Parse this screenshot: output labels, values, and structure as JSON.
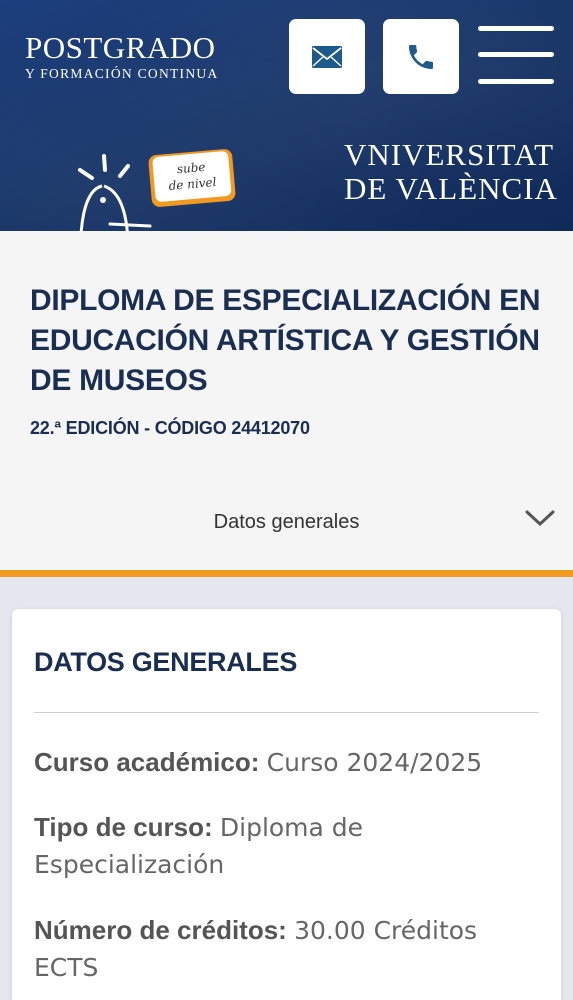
{
  "header": {
    "logo_main": "POSTGRADO",
    "logo_sub": "Y FORMACIÓN CONTINUA",
    "mail_icon": "envelope-icon",
    "phone_icon": "phone-icon",
    "menu_icon": "hamburger-menu-icon",
    "badge_text_line1": "sube",
    "badge_text_line2": "de nivel",
    "university_line1": "VNIVERSITAT",
    "university_line2": "DE VALÈNCIA",
    "accent_color": "#f19a21",
    "brand_color": "#163468"
  },
  "course": {
    "title": "DIPLOMA DE ESPECIALIZACIÓN EN EDUCACIÓN ARTÍSTICA Y GESTIÓN DE MUSEOS",
    "edition_code": "22.ª EDICIÓN - CÓDIGO 24412070"
  },
  "section_selector": {
    "label": "Datos generales",
    "icon": "chevron-down-icon"
  },
  "general_data": {
    "heading": "DATOS GENERALES",
    "rows": [
      {
        "label": "Curso académico:",
        "value": "Curso 2024/2025"
      },
      {
        "label": "Tipo de curso:",
        "value": "Diploma de Especialización"
      },
      {
        "label": "Número de créditos:",
        "value": "30.00 Créditos ECTS"
      }
    ]
  }
}
